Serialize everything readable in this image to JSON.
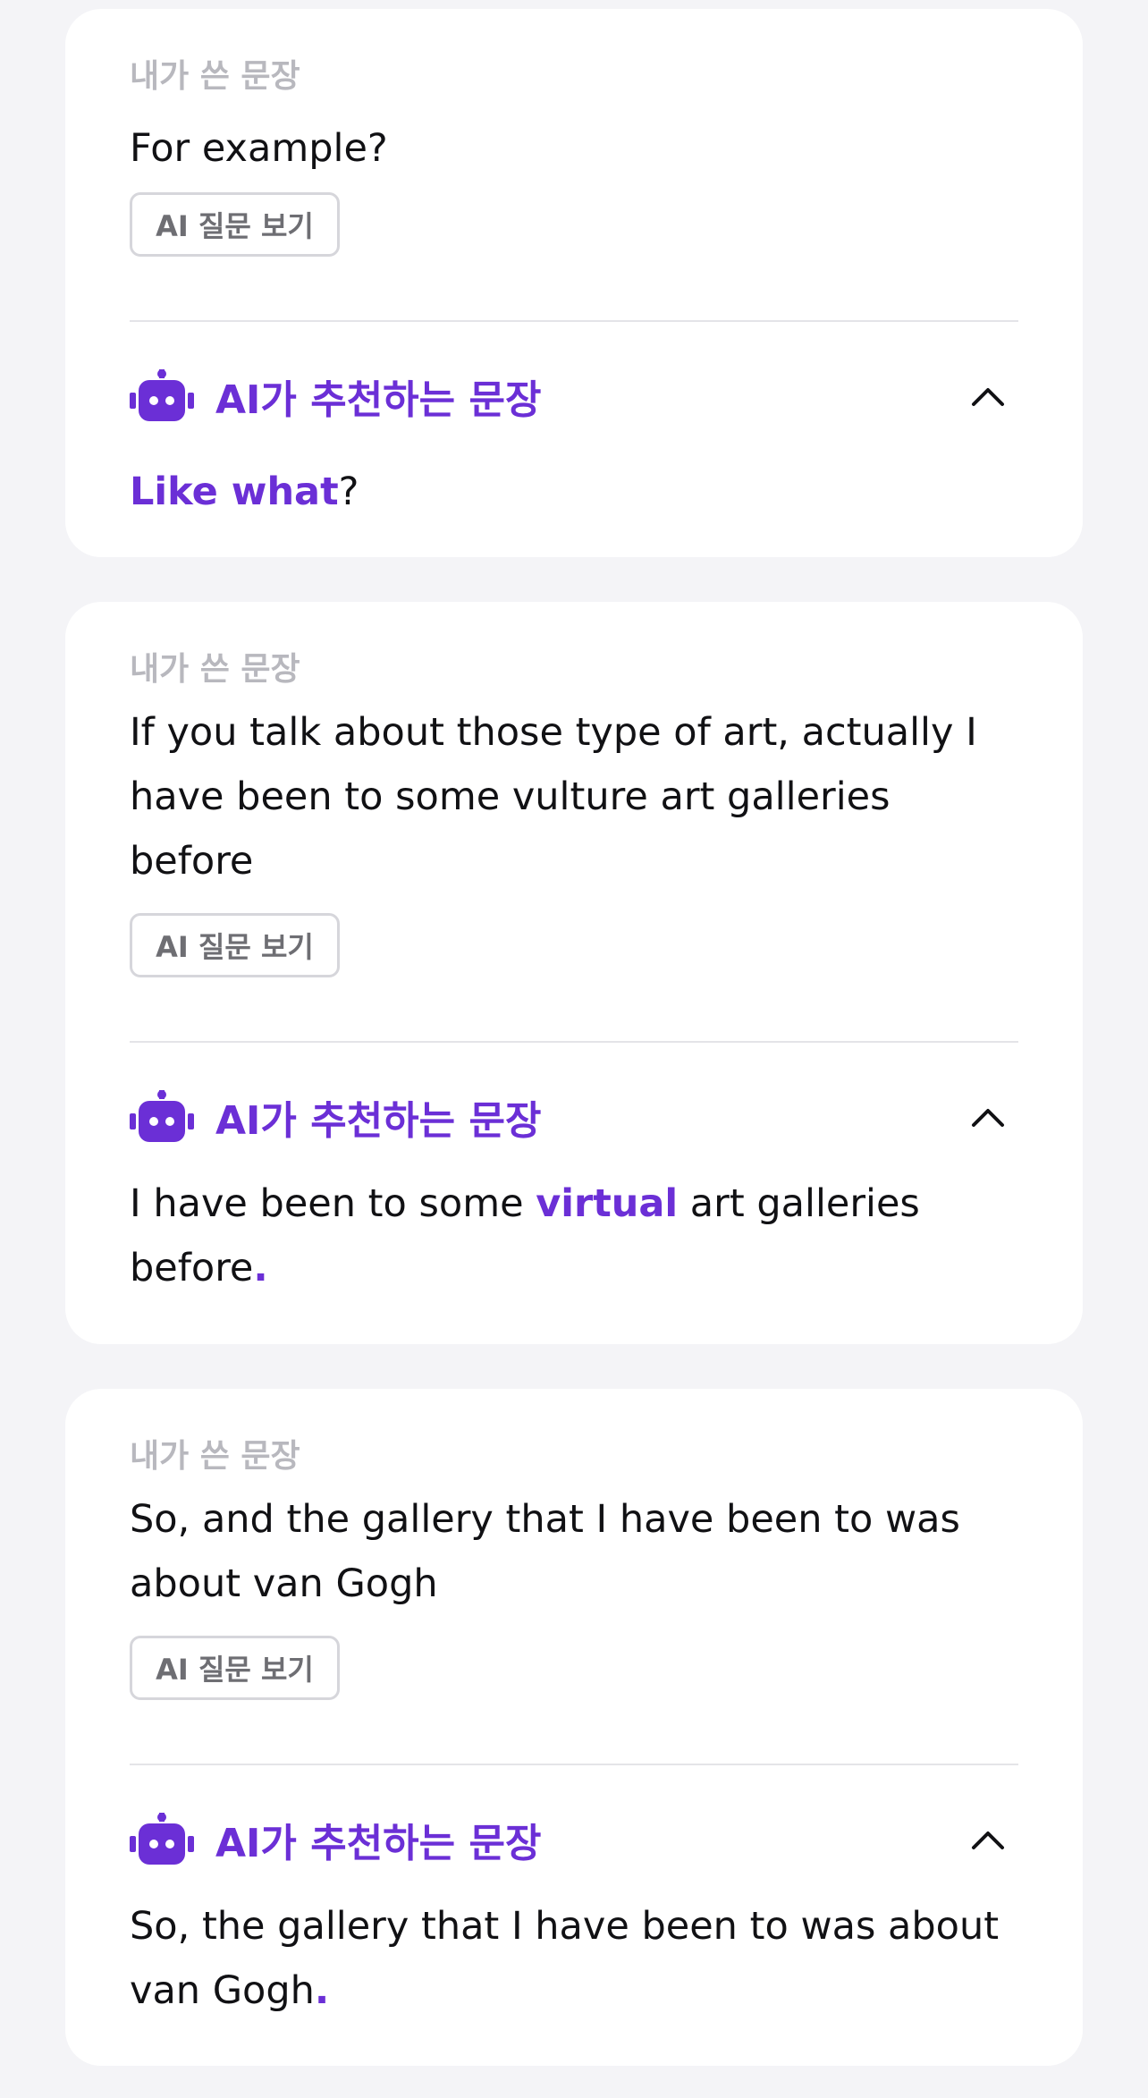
{
  "colors": {
    "accent": "#6b2fd6",
    "background": "#f4f4f7",
    "card": "#ffffff",
    "label": "#b8b8be"
  },
  "icons": {
    "robot": "robot-icon",
    "collapse": "chevron-up-icon"
  },
  "cards": [
    {
      "label": "내가 쓴 문장",
      "user_sentence": "For example?",
      "ai_question_button": "AI 질문 보기",
      "ai_title": "AI가 추천하는 문장",
      "suggestion": {
        "s1_hl": "Like what",
        "s2": "?"
      }
    },
    {
      "label": "내가 쓴 문장",
      "user_sentence": "If you talk about those type of art, actually I have been to some vulture art galleries before",
      "ai_question_button": "AI 질문 보기",
      "ai_title": "AI가 추천하는 문장",
      "suggestion": {
        "s1": "I have been to some ",
        "s2_hl": "virtual",
        "s3": " art galleries before",
        "s4_hl": "."
      }
    },
    {
      "label": "내가 쓴 문장",
      "user_sentence": "So, and the gallery that I have been to was about van Gogh",
      "ai_question_button": "AI 질문 보기",
      "ai_title": "AI가 추천하는 문장",
      "suggestion": {
        "s1": "So, the gallery that I have been to was about van Gogh",
        "s2_hl": "."
      }
    }
  ]
}
